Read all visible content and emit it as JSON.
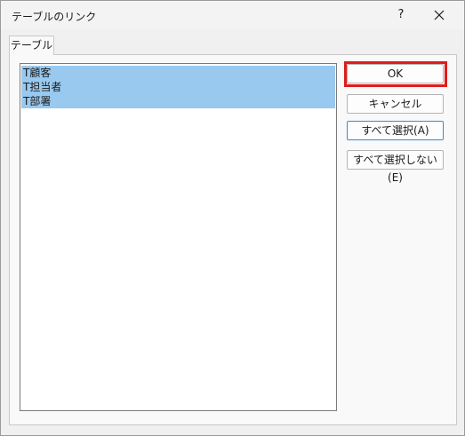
{
  "window": {
    "title": "テーブルのリンク",
    "help_label": "?",
    "close_icon": "close-icon"
  },
  "tabs": [
    {
      "label": "テーブル"
    }
  ],
  "tables_list": {
    "items": [
      {
        "label": "T顧客",
        "selected": true
      },
      {
        "label": "T担当者",
        "selected": true
      },
      {
        "label": "T部署",
        "selected": true
      }
    ]
  },
  "buttons": {
    "ok": "OK",
    "cancel": "キャンセル",
    "select_all": "すべて選択(A)",
    "deselect_all": "すべて選択しない(E)"
  },
  "colors": {
    "selection": "#99c9ef",
    "highlight": "#e01b1b",
    "focus": "#3a8ad6"
  }
}
